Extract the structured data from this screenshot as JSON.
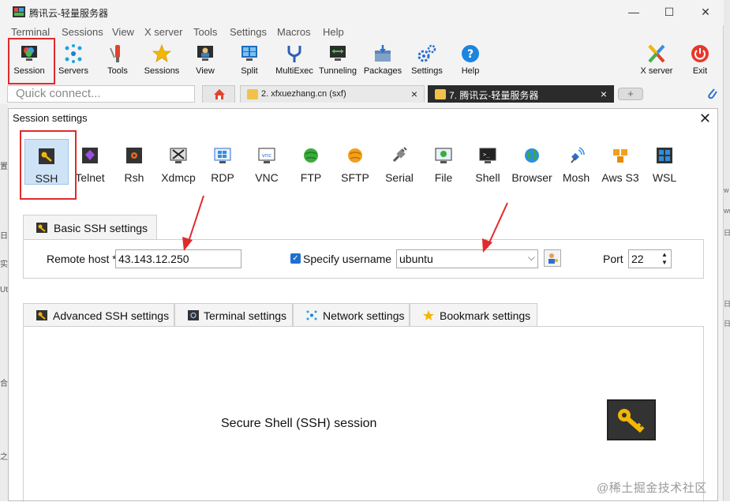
{
  "window": {
    "title": "腾讯云-轻量服务器",
    "min": "—",
    "max": "☐",
    "close": "✕"
  },
  "menu": [
    "Terminal",
    "Sessions",
    "View",
    "X server",
    "Tools",
    "Settings",
    "Macros",
    "Help"
  ],
  "toolbar": [
    {
      "label": "Session",
      "icon": "monitor-icon"
    },
    {
      "label": "Servers",
      "icon": "servers-icon"
    },
    {
      "label": "Tools",
      "icon": "tools-icon"
    },
    {
      "label": "Sessions",
      "icon": "star-icon"
    },
    {
      "label": "View",
      "icon": "view-icon"
    },
    {
      "label": "Split",
      "icon": "split-icon"
    },
    {
      "label": "MultiExec",
      "icon": "fork-icon"
    },
    {
      "label": "Tunneling",
      "icon": "tunnel-icon"
    },
    {
      "label": "Packages",
      "icon": "package-icon"
    },
    {
      "label": "Settings",
      "icon": "gears-icon"
    },
    {
      "label": "Help",
      "icon": "help-icon"
    },
    {
      "label": "X server",
      "icon": "x-icon"
    },
    {
      "label": "Exit",
      "icon": "power-icon"
    }
  ],
  "quick_connect": {
    "placeholder": "Quick connect..."
  },
  "tabs": [
    {
      "label": "2. xfxuezhang.cn (sxf)",
      "active": false
    },
    {
      "label": "7. 腾讯云-轻量服务器",
      "active": true
    }
  ],
  "tab_add": "+",
  "dialog": {
    "title": "Session settings",
    "close": "✕",
    "protocols": [
      "SSH",
      "Telnet",
      "Rsh",
      "Xdmcp",
      "RDP",
      "VNC",
      "FTP",
      "SFTP",
      "Serial",
      "File",
      "Shell",
      "Browser",
      "Mosh",
      "Aws S3",
      "WSL"
    ],
    "selected_protocol": "SSH",
    "basic_tab": "Basic SSH settings",
    "remote_host_label": "Remote host *",
    "remote_host_value": "43.143.12.250",
    "specify_username_label": "Specify username",
    "specify_username_checked": true,
    "username_value": "ubuntu",
    "port_label": "Port",
    "port_value": "22",
    "sub_tabs": [
      "Advanced SSH settings",
      "Terminal settings",
      "Network settings",
      "Bookmark settings"
    ],
    "description": "Secure Shell (SSH) session"
  },
  "left_strip_text": [
    "置",
    "日",
    "实",
    "Ut",
    "合",
    "之"
  ],
  "right_strip_text": [
    "w",
    "ww",
    "日",
    "日",
    "日"
  ],
  "watermark": "@稀土掘金技术社区",
  "colors": {
    "highlight_red": "#e02b2b",
    "selected_blue": "#cfe3f7",
    "active_tab": "#2b2b2b",
    "check_blue": "#1f6fd1"
  }
}
